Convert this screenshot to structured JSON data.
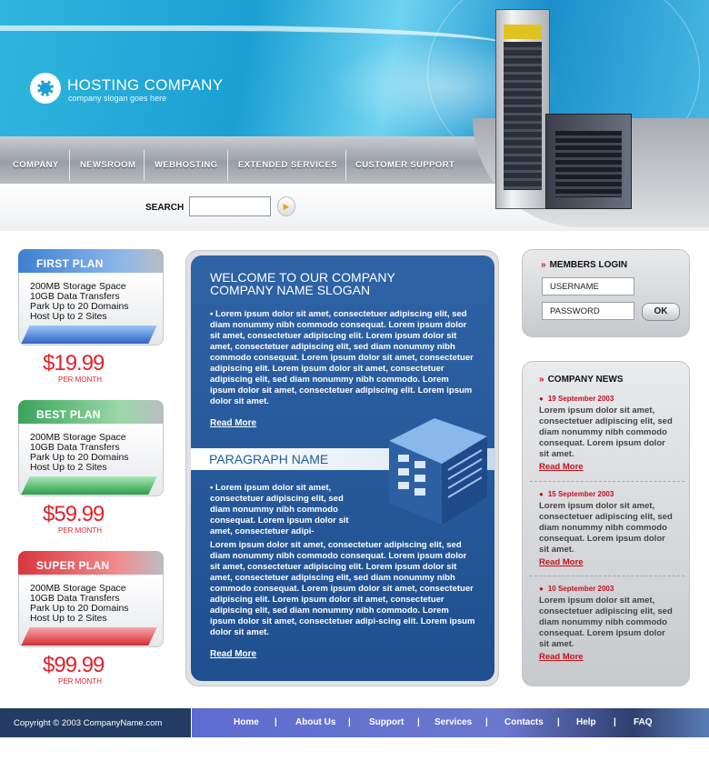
{
  "header": {
    "title": "HOSTING COMPANY",
    "slogan": "company slogan goes here"
  },
  "nav": {
    "items": [
      "COMPANY",
      "NEWSROOM",
      "WEBHOSTING",
      "EXTENDED SERVICES",
      "CUSTOMER SUPPORT"
    ]
  },
  "search": {
    "label": "SEARCH",
    "value": ""
  },
  "plans": [
    {
      "name": "FIRST PLAN",
      "features": [
        "200MB Storage Space",
        "10GB Data Transfers",
        "Park Up to 20 Domains",
        "Host Up to 2 Sites"
      ],
      "price": "$19.99",
      "period": "PER MONTH",
      "color": "#5b8fd6"
    },
    {
      "name": "BEST PLAN",
      "features": [
        "200MB Storage Space",
        "10GB Data Transfers",
        "Park Up to 20 Domains",
        "Host Up to 2 Sites"
      ],
      "price": "$59.99",
      "period": "PER MONTH",
      "color": "#4fb068"
    },
    {
      "name": "SUPER PLAN",
      "features": [
        "200MB Storage Space",
        "10GB Data Transfers",
        "Park Up to 20 Domains",
        "Host Up to 2 Sites"
      ],
      "price": "$99.99",
      "period": "PER MONTH",
      "color": "#e0484d"
    }
  ],
  "main": {
    "heading_line1": "WELCOME TO OUR COMPANY",
    "heading_line2": "COMPANY NAME SLOGAN",
    "intro": "• Lorem ipsum dolor sit amet, consectetuer adipiscing elit, sed diam nonummy nibh commodo consequat. Lorem ipsum dolor sit amet, consectetuer adipiscing elit. Lorem ipsum dolor sit amet, consectetuer adipiscing elit, sed diam nonummy nibh commodo consequat. Lorem ipsum dolor sit amet, consectetuer adipiscing elit. Lorem ipsum dolor sit amet, consectetuer adipiscing elit, sed diam nonummy nibh commodo. Lorem ipsum dolor sit amet, consectetuer adipiscing elit. Lorem ipsum dolor sit amet.",
    "read_more_1": "Read More",
    "paragraph_title": "PARAGRAPH NAME",
    "para_intro": "• Lorem ipsum dolor sit amet, consectetuer adipiscing elit, sed diam nonummy nibh commodo consequat. Lorem ipsum dolor sit amet, consectetuer adipi-",
    "para_body": "Lorem ipsum dolor sit amet, consectetuer adipiscing elit, sed diam nonummy nibh commodo consequat. Lorem ipsum dolor sit amet, consectetuer adipiscing elit. Lorem ipsum dolor sit amet, consectetuer adipiscing elit, sed diam nonummy nibh commodo consequat. Lorem ipsum dolor sit amet, consectetuer adipiscing elit. Lorem ipsum dolor sit amet, consectetuer adipiscing elit, sed diam nonummy nibh commodo. Lorem ipsum dolor sit amet, consectetuer adipi-scing elit. Lorem ipsum dolor sit amet.",
    "read_more_2": "Read More"
  },
  "login": {
    "title": "MEMBERS LOGIN",
    "username_placeholder": "USERNAME",
    "password_placeholder": "PASSWORD",
    "ok_label": "OK"
  },
  "news": {
    "title": "COMPANY NEWS",
    "items": [
      {
        "date": "19 September 2003",
        "text": "Lorem ipsum dolor sit amet, consectetuer adipiscing elit, sed diam nonummy nibh commodo consequat. Lorem ipsum dolor sit amet.",
        "more": "Read More"
      },
      {
        "date": "15 September 2003",
        "text": "Lorem ipsum dolor sit amet, consectetuer adipiscing elit, sed diam nonummy nibh commodo consequat. Lorem ipsum dolor sit amet.",
        "more": "Read More"
      },
      {
        "date": "10 September 2003",
        "text": "Lorem ipsum dolor sit amet, consectetuer adipiscing elit, sed diam nonummy nibh commodo consequat. Lorem ipsum dolor sit amet.",
        "more": "Read More"
      }
    ]
  },
  "footer": {
    "copyright": "Copyright © 2003  CompanyName.com",
    "links": [
      "Home",
      "About Us",
      "Support",
      "Services",
      "Contacts",
      "Help",
      "FAQ"
    ],
    "separator": "|"
  },
  "icons": {
    "logo": "sun-logo-icon",
    "search_go": "arrow-right-icon",
    "bullet": "red-arrow-icon"
  }
}
